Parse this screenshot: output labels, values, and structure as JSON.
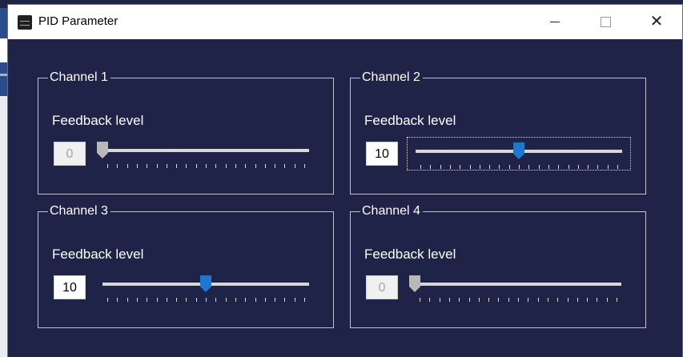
{
  "window": {
    "title": "PID Parameter",
    "controls": {
      "minimize_icon": "minimize-icon",
      "maximize_icon": "maximize-icon",
      "close_symbol": "✕"
    }
  },
  "colors": {
    "window_bg": "#1f2347",
    "thumb_active": "#1e78d0",
    "thumb_disabled": "#b8b8b8",
    "text": "#ffffff"
  },
  "channels": [
    {
      "title": "Channel 1",
      "label": "Feedback level",
      "value": "0",
      "enabled": false,
      "slider_fraction": 0.0,
      "focused": false
    },
    {
      "title": "Channel 2",
      "label": "Feedback level",
      "value": "10",
      "enabled": true,
      "slider_fraction": 0.5,
      "focused": true
    },
    {
      "title": "Channel 3",
      "label": "Feedback level",
      "value": "10",
      "enabled": true,
      "slider_fraction": 0.5,
      "focused": false
    },
    {
      "title": "Channel 4",
      "label": "Feedback level",
      "value": "0",
      "enabled": false,
      "slider_fraction": 0.0,
      "focused": false
    }
  ],
  "slider": {
    "min": 0,
    "max": 20,
    "tick_count": 21
  }
}
